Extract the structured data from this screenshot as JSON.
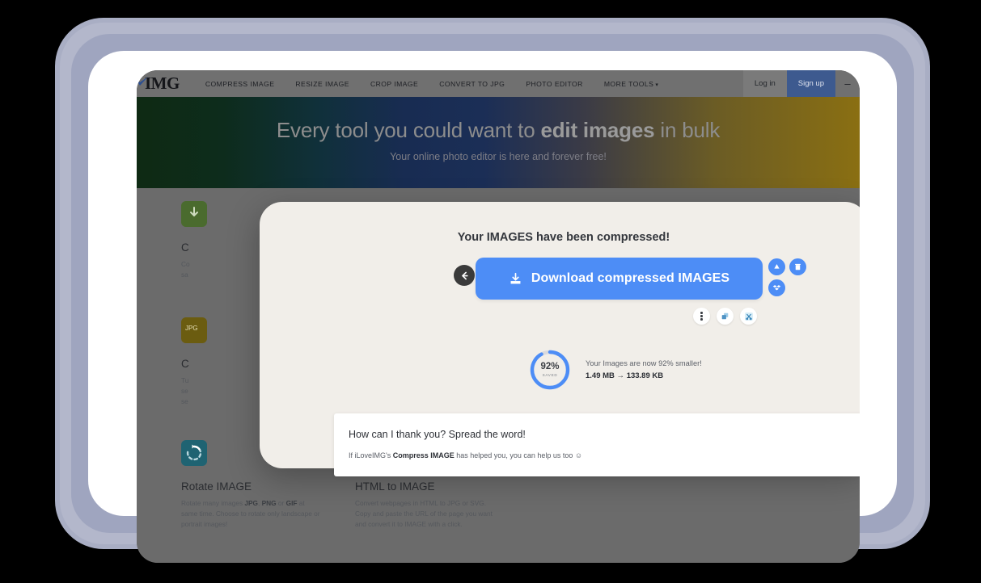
{
  "navbar": {
    "logo": "IMG",
    "links": [
      {
        "label": "COMPRESS IMAGE",
        "caret": false
      },
      {
        "label": "RESIZE IMAGE",
        "caret": false
      },
      {
        "label": "CROP IMAGE",
        "caret": false
      },
      {
        "label": "CONVERT TO JPG",
        "caret": false
      },
      {
        "label": "PHOTO EDITOR",
        "caret": false
      },
      {
        "label": "MORE TOOLS",
        "caret": true
      }
    ],
    "caret_glyph": "▾",
    "login_label": "Log in",
    "signup_label": "Sign up",
    "menu_glyph": "–"
  },
  "hero": {
    "title_before": "Every tool you could want to ",
    "title_bold": "edit images",
    "title_after": " in bulk",
    "subtitle": "Your online photo editor is here and forever free!"
  },
  "tools": [
    {
      "name": "C",
      "desc_html": "Co\nsa",
      "icon_color": "#4a6b2e",
      "icon_kind": "compress"
    },
    {
      "name": "C",
      "desc_html": "Tu\nse\nse",
      "icon_color": "#6b5c10",
      "icon_kind": "jpg"
    },
    {
      "name": "Rotate IMAGE",
      "desc_p1": "Rotate many images ",
      "desc_b1": "JPG",
      "desc_p2": ", ",
      "desc_b2": "PNG",
      "desc_p3": " or ",
      "desc_b3": "GIF",
      "desc_p4": " at same time. Choose to rotate only landscape or portrait images!",
      "icon_color": "#1f6372",
      "icon_kind": "rotate"
    },
    {
      "name": "HTML to IMAGE",
      "desc_p1": "Convert webpages in HTML to JPG or SVG. Copy and paste the URL of the page you want and convert it to IMAGE with a click.",
      "icon_color": "#6b5c10",
      "icon_kind": "html"
    }
  ],
  "modal": {
    "title": "Your IMAGES have been compressed!",
    "back_icon": "arrow-left-icon",
    "download_label": "Download compressed IMAGES",
    "download_icon": "download-icon",
    "gdrive_icon": "google-drive-icon",
    "trash_icon": "trash-icon",
    "dropbox_icon": "dropbox-icon",
    "small_icons": [
      "more-options-icon",
      "copy-link-icon",
      "cut-icon"
    ],
    "accent_blue": "#4d8df6",
    "background": "#f1eee9"
  },
  "stats": {
    "percent_value": "92%",
    "percent_caption": "SAVED",
    "percent_number": 92,
    "line1": "Your Images are now 92% smaller!",
    "size_before": "1.49 MB",
    "arrow": "→",
    "size_after": "133.89 KB",
    "ring_color": "#4d8df6",
    "ring_track": "#d9dade"
  },
  "thanks": {
    "title": "How can I thank you? Spread the word!",
    "sub_p1": "If iLoveIMG's ",
    "sub_b1": "Compress IMAGE",
    "sub_p2": " has helped you, you can help us too ☺"
  }
}
